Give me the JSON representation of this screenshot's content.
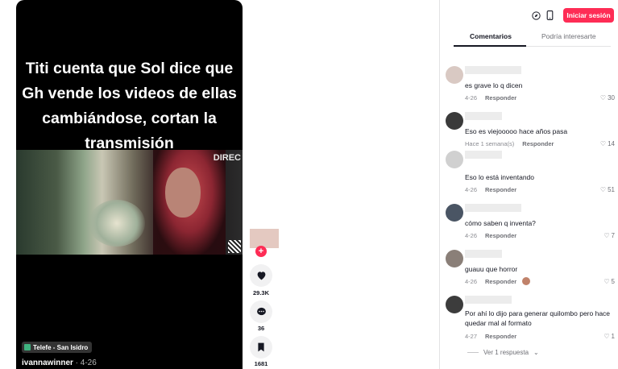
{
  "video": {
    "caption": "Titi cuenta que Sol dice que Gh vende los videos de ellas cambiándose,  cortan la transmisión",
    "channel_logo_text": "DIREC",
    "location_tag": "Telefe - San Isidro",
    "author": "ivannawinner",
    "date": " · 4-26"
  },
  "actions": {
    "plus": "+",
    "likes": "29.3K",
    "comments": "36",
    "saves": "1681"
  },
  "header": {
    "login_label": "Iniciar sesión"
  },
  "tabs": [
    {
      "label": "Comentarios"
    },
    {
      "label": "Podría interesarte"
    }
  ],
  "comments": [
    {
      "text": "es grave lo q dicen",
      "date": "4-26",
      "reply": "Responder",
      "likes": "30"
    },
    {
      "text": "Eso es viejooooo hace años pasa",
      "date": "Hace 1 semana(s)",
      "reply": "Responder",
      "likes": "14"
    },
    {
      "text": "Eso lo está inventando",
      "date": "4-26",
      "reply": "Responder",
      "likes": "51"
    },
    {
      "text": "cómo saben q inventa?",
      "date": "4-26",
      "reply": "Responder",
      "likes": "7"
    },
    {
      "text": "guauu que horror",
      "date": "4-26",
      "reply": "Responder",
      "likes": "5"
    },
    {
      "text": "Por ahí lo dijo para generar quilombo pero hace quedar mal al formato",
      "date": "4-27",
      "reply": "Responder",
      "likes": "1"
    }
  ],
  "view_more": "Ver 1 respuesta",
  "colors": {
    "accent": "#fe2c55",
    "text": "#161823",
    "muted": "#8a8b91"
  }
}
